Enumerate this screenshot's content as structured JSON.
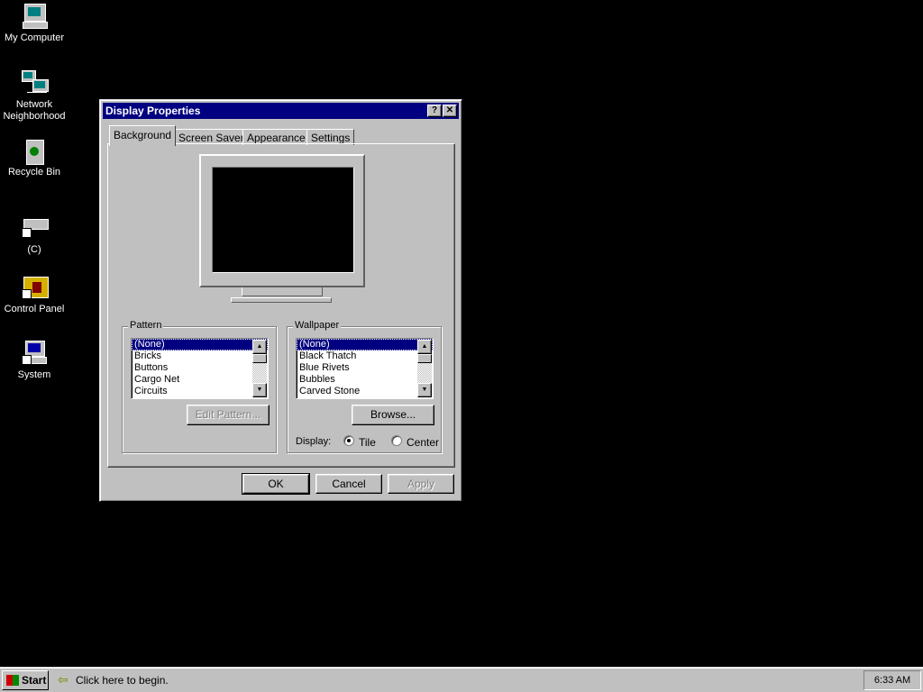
{
  "desktop": {
    "icons": [
      {
        "label": "My Computer",
        "icon": "my-computer-icon"
      },
      {
        "label": "Network Neighborhood",
        "icon": "network-neighborhood-icon"
      },
      {
        "label": "Recycle Bin",
        "icon": "recycle-bin-icon"
      },
      {
        "label": "(C)",
        "icon": "drive-shortcut-icon"
      },
      {
        "label": "Control Panel",
        "icon": "control-panel-icon"
      },
      {
        "label": "System",
        "icon": "system-icon"
      }
    ]
  },
  "dialog": {
    "title": "Display Properties",
    "help_glyph": "?",
    "close_glyph": "✕",
    "tabs": [
      {
        "label": "Background",
        "active": true
      },
      {
        "label": "Screen Saver",
        "active": false
      },
      {
        "label": "Appearance",
        "active": false
      },
      {
        "label": "Settings",
        "active": false
      }
    ],
    "pattern": {
      "label": "Pattern",
      "items": [
        "(None)",
        "Bricks",
        "Buttons",
        "Cargo Net",
        "Circuits"
      ],
      "selected": "(None)",
      "edit_button": "Edit Pattern..."
    },
    "wallpaper": {
      "label": "Wallpaper",
      "items": [
        "(None)",
        "Black Thatch",
        "Blue Rivets",
        "Bubbles",
        "Carved Stone"
      ],
      "selected": "(None)",
      "browse_button": "Browse...",
      "display_label": "Display:",
      "display_options": [
        "Tile",
        "Center"
      ],
      "display_selected": "Tile"
    },
    "buttons": {
      "ok": "OK",
      "cancel": "Cancel",
      "apply": "Apply"
    }
  },
  "taskbar": {
    "start_label": "Start",
    "hint": "Click here to begin.",
    "clock": "6:33 AM"
  },
  "colors": {
    "desktop": "#000000",
    "titlebar": "#000080",
    "face": "#c0c0c0"
  }
}
